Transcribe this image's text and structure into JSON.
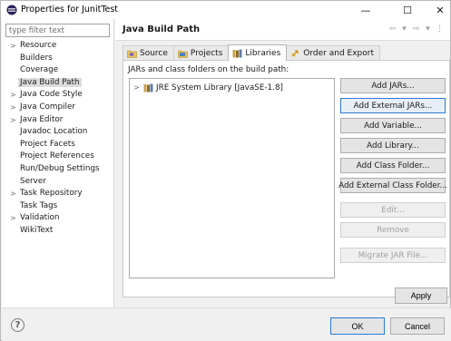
{
  "window": {
    "title": "Properties for JunitTest",
    "minimize": "—",
    "maximize": "☐",
    "close": "✕"
  },
  "filter": {
    "placeholder": "type filter text",
    "value": ""
  },
  "nav": {
    "items": [
      {
        "label": "Resource",
        "expandable": true
      },
      {
        "label": "Builders",
        "expandable": false
      },
      {
        "label": "Coverage",
        "expandable": false
      },
      {
        "label": "Java Build Path",
        "expandable": false,
        "selected": true
      },
      {
        "label": "Java Code Style",
        "expandable": true
      },
      {
        "label": "Java Compiler",
        "expandable": true
      },
      {
        "label": "Java Editor",
        "expandable": true
      },
      {
        "label": "Javadoc Location",
        "expandable": false
      },
      {
        "label": "Project Facets",
        "expandable": false
      },
      {
        "label": "Project References",
        "expandable": false
      },
      {
        "label": "Run/Debug Settings",
        "expandable": false
      },
      {
        "label": "Server",
        "expandable": false
      },
      {
        "label": "Task Repository",
        "expandable": true
      },
      {
        "label": "Task Tags",
        "expandable": false
      },
      {
        "label": "Validation",
        "expandable": true
      },
      {
        "label": "WikiText",
        "expandable": false
      }
    ]
  },
  "page": {
    "title": "Java Build Path"
  },
  "tabs": [
    {
      "label": "Source",
      "icon": "source-folder-icon",
      "active": false
    },
    {
      "label": "Projects",
      "icon": "projects-icon",
      "active": false
    },
    {
      "label": "Libraries",
      "icon": "libraries-icon",
      "active": true
    },
    {
      "label": "Order and Export",
      "icon": "order-export-icon",
      "active": false
    }
  ],
  "libraries": {
    "label": "JARs and class folders on the build path:",
    "tree": [
      {
        "label": "JRE System Library [JavaSE-1.8]",
        "icon": "library-icon"
      }
    ]
  },
  "buttons": {
    "add_jars": "Add JARs...",
    "add_external_jars": "Add External JARs...",
    "add_variable": "Add Variable...",
    "add_library": "Add Library...",
    "add_class_folder": "Add Class Folder...",
    "add_external_class_folder": "Add External Class Folder...",
    "edit": "Edit...",
    "remove": "Remove",
    "migrate_jar": "Migrate JAR File...",
    "apply": "Apply",
    "ok": "OK",
    "cancel": "Cancel"
  },
  "colors": {
    "accent": "#2a7ad6",
    "selection": "#dcdcdc"
  }
}
